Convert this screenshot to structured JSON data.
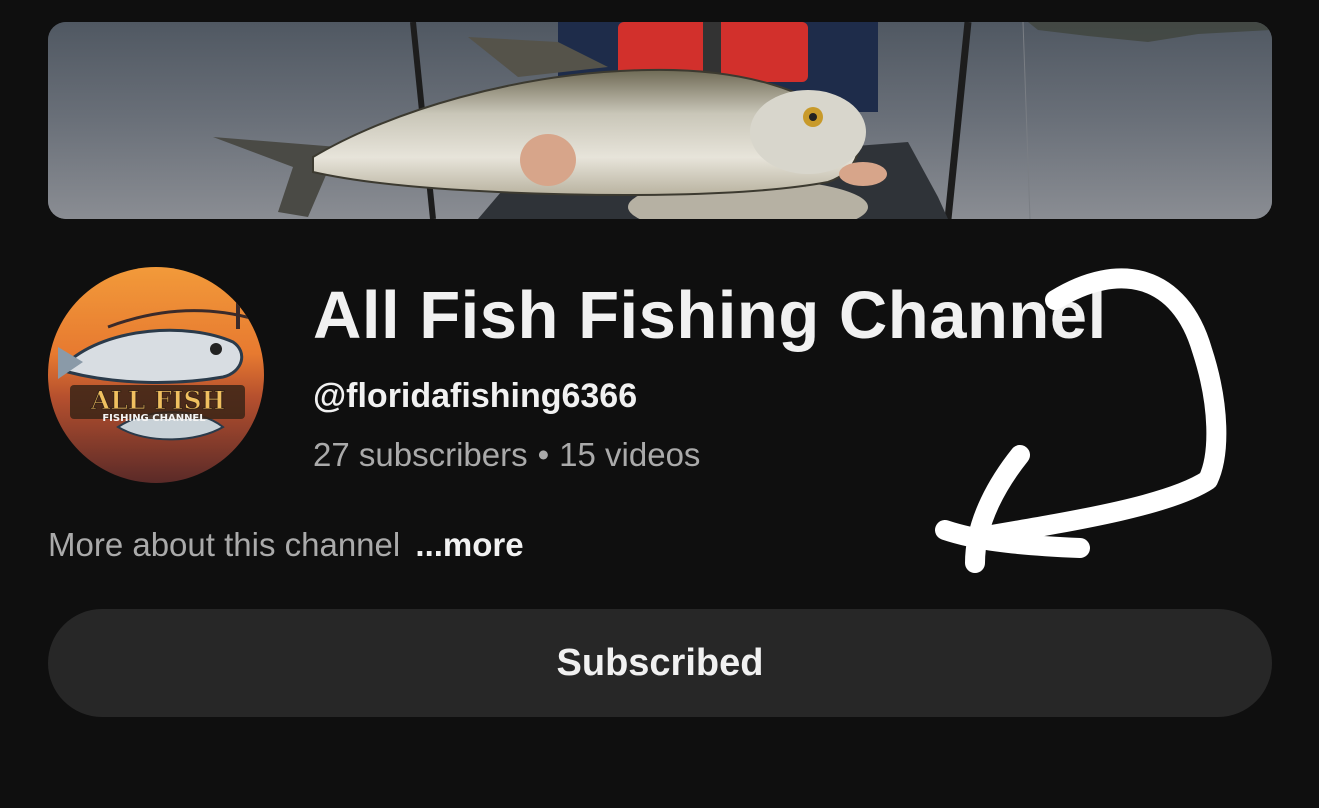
{
  "channel": {
    "name": "All Fish Fishing Channel",
    "handle": "@floridafishing6366",
    "subscribers": "27 subscribers",
    "separator": "•",
    "videos": "15 videos"
  },
  "avatar": {
    "logo_line1": "ALL FISH",
    "logo_line2": "FISHING CHANNEL"
  },
  "about": {
    "text": "More about this channel",
    "more_label": "...more"
  },
  "subscribe_button": {
    "label": "Subscribed"
  },
  "annotation": {
    "type": "hand-drawn-arrow",
    "color": "#ffffff"
  },
  "colors": {
    "background": "#0f0f0f",
    "button_bg": "#272727",
    "primary_text": "#f1f1f1",
    "secondary_text": "#aaaaaa"
  }
}
